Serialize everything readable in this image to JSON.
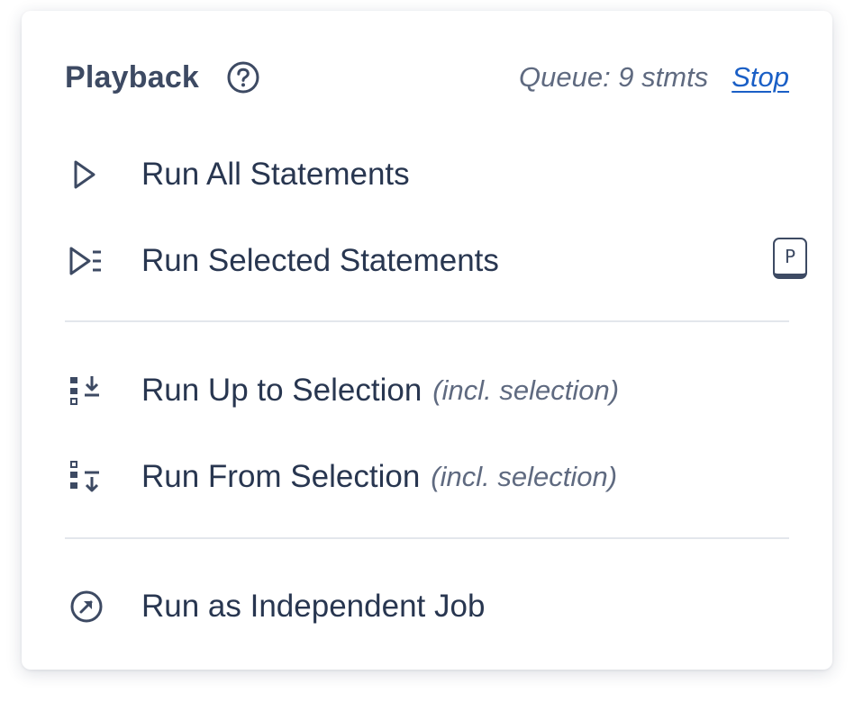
{
  "menu": {
    "title": "Playback",
    "queue_text": "Queue: 9 stmts",
    "stop_label": "Stop",
    "items": [
      {
        "label": "Run All Statements",
        "note": "",
        "icon": "play-outline-icon"
      },
      {
        "label": "Run Selected Statements",
        "note": "",
        "icon": "play-selected-icon",
        "shortcut": "P"
      },
      {
        "label": "Run Up to Selection",
        "note": "(incl. selection)",
        "icon": "run-up-to-icon"
      },
      {
        "label": "Run From Selection",
        "note": "(incl. selection)",
        "icon": "run-from-icon"
      },
      {
        "label": "Run as Independent Job",
        "note": "",
        "icon": "external-arrow-circle-icon"
      }
    ]
  },
  "colors": {
    "text": "#283650",
    "muted": "#5f6a80",
    "link": "#1a5fc6",
    "divider": "#e3e6ec"
  }
}
